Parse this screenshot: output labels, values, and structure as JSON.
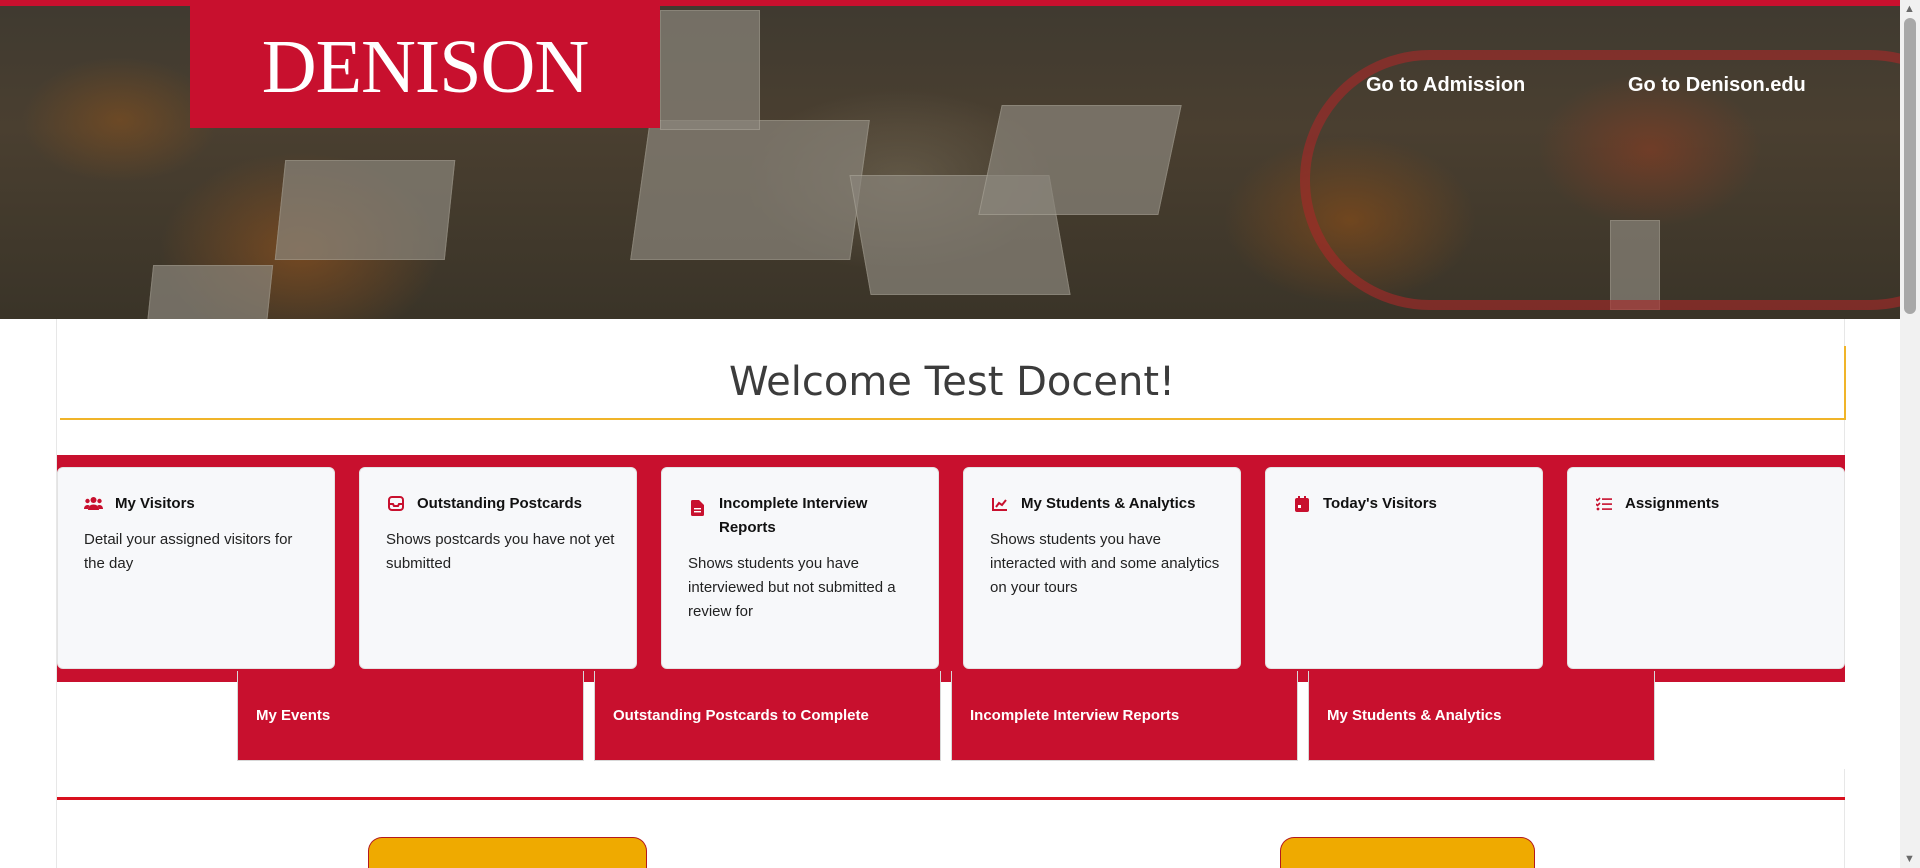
{
  "header": {
    "logo_text": "DENISON",
    "links": [
      {
        "label": "Go to Admission"
      },
      {
        "label": "Go to Denison.edu"
      }
    ]
  },
  "welcome": {
    "title": "Welcome Test Docent!"
  },
  "cards": [
    {
      "title": "My Visitors",
      "description": "Detail your assigned visitors for the day",
      "icon": "users-icon"
    },
    {
      "title": "Outstanding Postcards",
      "description": "Shows postcards you have not yet submitted",
      "icon": "inbox-icon"
    },
    {
      "title": "Incomplete Interview Reports",
      "description": "Shows students you have interviewed but not submitted a review for",
      "icon": "file-icon"
    },
    {
      "title": "My Students & Analytics",
      "description": "Shows students you have interacted with and some analytics on your tours",
      "icon": "chart-line-icon"
    },
    {
      "title": "Today's Visitors",
      "description": "",
      "icon": "calendar-icon"
    },
    {
      "title": "Assignments",
      "description": "",
      "icon": "list-check-icon"
    }
  ],
  "buttons": [
    {
      "label": "My Events"
    },
    {
      "label": "Outstanding Postcards to Complete"
    },
    {
      "label": "Incomplete Interview Reports"
    },
    {
      "label": "My Students & Analytics"
    }
  ],
  "colors": {
    "brand_red": "#c8102e",
    "accent_gold": "#f0b429",
    "card_bg": "#f7f8fa"
  }
}
